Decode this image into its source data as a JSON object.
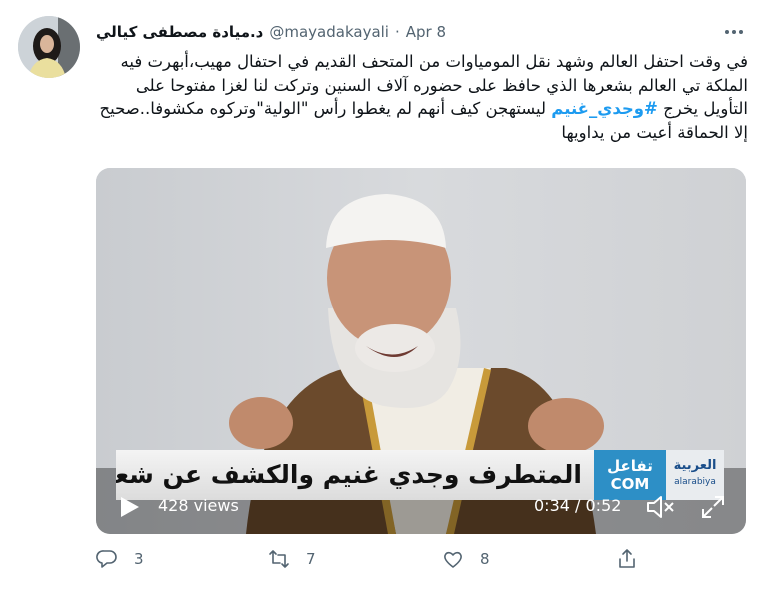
{
  "tweet": {
    "display_name": "د.ميادة مصطفى كيالي",
    "handle": "@mayadakayali",
    "separator": "·",
    "date": "Apr 8",
    "more_label": "•••",
    "text_part1": "في وقت احتفل العالم وشهد نقل المومياوات من المتحف القديم في احتفال مهيب،أبهرت فيه الملكة تي العالم بشعرها الذي حافظ على حضوره آلاف السنين وتركت لنا لغزا مفتوحا على التأويل يخرج ",
    "hashtag": "#وجدي_غنيم",
    "text_part2": " ليستهجن كيف أنهم لم يغطوا رأس \"الولية\"وتركوه مكشوفا..صحيح إلا الحماقة أعيت من يداويها"
  },
  "video": {
    "caption": "المتطرف وجدي غنيم والكشف عن شعر مومياء !",
    "logo_tafaul": "تفاعل",
    "logo_com": "COM",
    "logo_arabiya": "العربية",
    "logo_arabiya_sub": "alarabiya",
    "views": "428 views",
    "time": "0:34 / 0:52"
  },
  "actions": {
    "replies": "3",
    "retweets": "7",
    "likes": "8"
  },
  "colors": {
    "hashtag": "#1d9bf0",
    "muted": "#536471"
  }
}
